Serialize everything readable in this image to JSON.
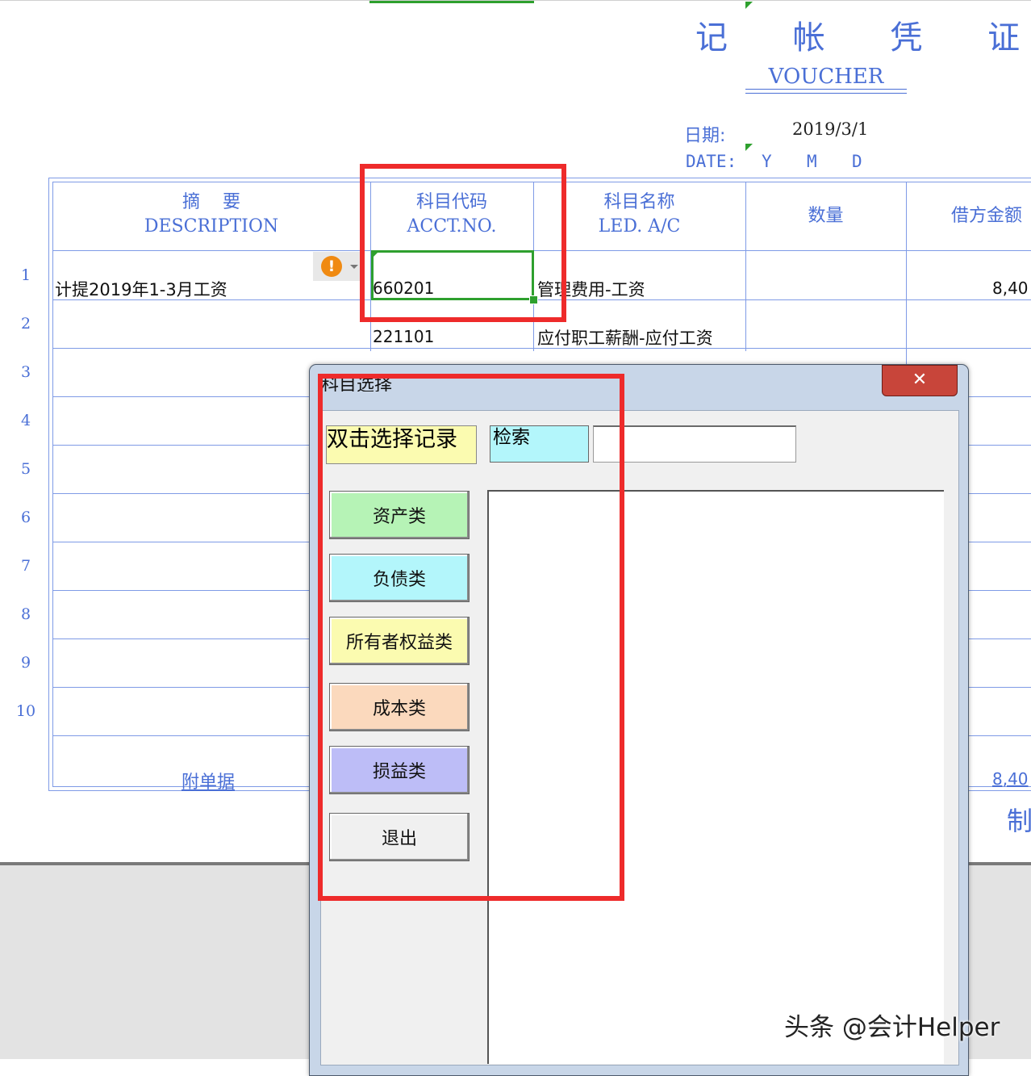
{
  "voucher": {
    "title_cn": "记 帐 凭 证",
    "title_en": "VOUCHER",
    "date_label_cn": "日期:",
    "date_value": "2019/3/1",
    "date_label_en": "DATE:",
    "date_y": "Y",
    "date_m": "M",
    "date_d": "D"
  },
  "table": {
    "headers": {
      "desc_cn": "摘    要",
      "desc_en": "DESCRIPTION",
      "acct_cn": "科目代码",
      "acct_en": "ACCT.NO.",
      "name_cn": "科目名称",
      "name_en": "LED. A/C",
      "qty": "数量",
      "debit": "借方金额"
    },
    "row_numbers": [
      "1",
      "2",
      "3",
      "4",
      "5",
      "6",
      "7",
      "8",
      "9",
      "10"
    ],
    "rows": [
      {
        "desc": "计提2019年1-3月工资",
        "acct": "660201",
        "name": "管理费用-工资",
        "debit": "8,40"
      },
      {
        "desc": "",
        "acct": "221101",
        "name": "应付职工薪酬-应付工资",
        "debit": ""
      }
    ],
    "footer_attach": "附单据",
    "footer_total": "8,40",
    "footer_maker": "制"
  },
  "dialog": {
    "title": "科目选择",
    "close_symbol": "✕",
    "hint_label": "双击选择记录",
    "search_label": "检索",
    "search_value": "",
    "buttons": {
      "assets": "资产类",
      "liabilities": "负债类",
      "equity": "所有者权益类",
      "cost": "成本类",
      "profit_loss": "损益类",
      "exit": "退出"
    }
  },
  "watermark": "头条 @会计Helper",
  "colors": {
    "accent_blue": "#4a6fd6",
    "highlight_red": "#ee2b2b",
    "active_green": "#2ea02e",
    "btn_assets": "#b6f3b6",
    "btn_liabilities": "#b3f6fb",
    "btn_equity": "#fbfbb0",
    "btn_cost": "#fbd9bd",
    "btn_profit_loss": "#bdbdf7"
  }
}
